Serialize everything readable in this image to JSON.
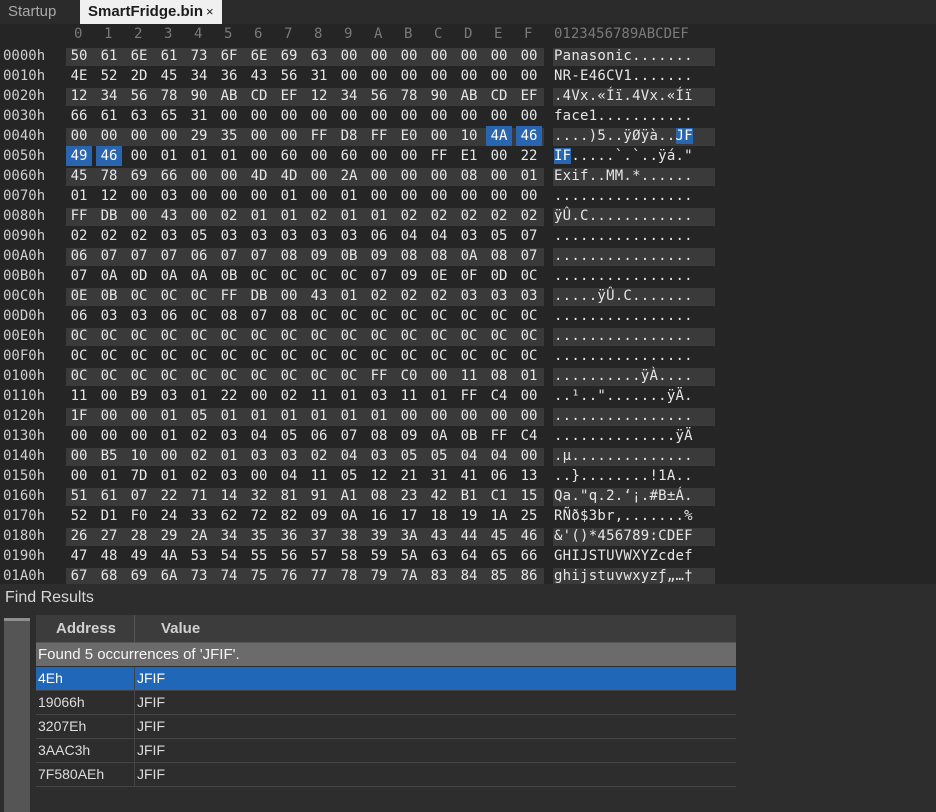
{
  "tabs": [
    {
      "label": "Startup",
      "active": false
    },
    {
      "label": "SmartFridge.bin",
      "active": true,
      "close": "×"
    }
  ],
  "hex_header": {
    "columns": [
      "0",
      "1",
      "2",
      "3",
      "4",
      "5",
      "6",
      "7",
      "8",
      "9",
      "A",
      "B",
      "C",
      "D",
      "E",
      "F"
    ],
    "ascii_header": "0123456789ABCDEF"
  },
  "selection": "JFIF at offset 4Eh–51h",
  "rows": [
    {
      "addr": "0000h",
      "bytes": [
        "50",
        "61",
        "6E",
        "61",
        "73",
        "6F",
        "6E",
        "69",
        "63",
        "00",
        "00",
        "00",
        "00",
        "00",
        "00",
        "00"
      ],
      "ascii": "Panasonic......."
    },
    {
      "addr": "0010h",
      "bytes": [
        "4E",
        "52",
        "2D",
        "45",
        "34",
        "36",
        "43",
        "56",
        "31",
        "00",
        "00",
        "00",
        "00",
        "00",
        "00",
        "00"
      ],
      "ascii": "NR-E46CV1......."
    },
    {
      "addr": "0020h",
      "bytes": [
        "12",
        "34",
        "56",
        "78",
        "90",
        "AB",
        "CD",
        "EF",
        "12",
        "34",
        "56",
        "78",
        "90",
        "AB",
        "CD",
        "EF"
      ],
      "ascii": ".4Vx.«Íï.4Vx.«Íï"
    },
    {
      "addr": "0030h",
      "bytes": [
        "66",
        "61",
        "63",
        "65",
        "31",
        "00",
        "00",
        "00",
        "00",
        "00",
        "00",
        "00",
        "00",
        "00",
        "00",
        "00"
      ],
      "ascii": "face1..........."
    },
    {
      "addr": "0040h",
      "bytes": [
        "00",
        "00",
        "00",
        "00",
        "29",
        "35",
        "00",
        "00",
        "FF",
        "D8",
        "FF",
        "E0",
        "00",
        "10",
        "4A",
        "46"
      ],
      "ascii": "....)5..ÿØÿà..JF"
    },
    {
      "addr": "0050h",
      "bytes": [
        "49",
        "46",
        "00",
        "01",
        "01",
        "01",
        "00",
        "60",
        "00",
        "60",
        "00",
        "00",
        "FF",
        "E1",
        "00",
        "22"
      ],
      "ascii": "IF.....`.`..ÿá.\""
    },
    {
      "addr": "0060h",
      "bytes": [
        "45",
        "78",
        "69",
        "66",
        "00",
        "00",
        "4D",
        "4D",
        "00",
        "2A",
        "00",
        "00",
        "00",
        "08",
        "00",
        "01"
      ],
      "ascii": "Exif..MM.*......"
    },
    {
      "addr": "0070h",
      "bytes": [
        "01",
        "12",
        "00",
        "03",
        "00",
        "00",
        "00",
        "01",
        "00",
        "01",
        "00",
        "00",
        "00",
        "00",
        "00",
        "00"
      ],
      "ascii": "................"
    },
    {
      "addr": "0080h",
      "bytes": [
        "FF",
        "DB",
        "00",
        "43",
        "00",
        "02",
        "01",
        "01",
        "02",
        "01",
        "01",
        "02",
        "02",
        "02",
        "02",
        "02"
      ],
      "ascii": "ÿÛ.C............"
    },
    {
      "addr": "0090h",
      "bytes": [
        "02",
        "02",
        "02",
        "03",
        "05",
        "03",
        "03",
        "03",
        "03",
        "03",
        "06",
        "04",
        "04",
        "03",
        "05",
        "07"
      ],
      "ascii": "................"
    },
    {
      "addr": "00A0h",
      "bytes": [
        "06",
        "07",
        "07",
        "07",
        "06",
        "07",
        "07",
        "08",
        "09",
        "0B",
        "09",
        "08",
        "08",
        "0A",
        "08",
        "07"
      ],
      "ascii": "................"
    },
    {
      "addr": "00B0h",
      "bytes": [
        "07",
        "0A",
        "0D",
        "0A",
        "0A",
        "0B",
        "0C",
        "0C",
        "0C",
        "0C",
        "07",
        "09",
        "0E",
        "0F",
        "0D",
        "0C"
      ],
      "ascii": "................"
    },
    {
      "addr": "00C0h",
      "bytes": [
        "0E",
        "0B",
        "0C",
        "0C",
        "0C",
        "FF",
        "DB",
        "00",
        "43",
        "01",
        "02",
        "02",
        "02",
        "03",
        "03",
        "03"
      ],
      "ascii": ".....ÿÛ.C......."
    },
    {
      "addr": "00D0h",
      "bytes": [
        "06",
        "03",
        "03",
        "06",
        "0C",
        "08",
        "07",
        "08",
        "0C",
        "0C",
        "0C",
        "0C",
        "0C",
        "0C",
        "0C",
        "0C"
      ],
      "ascii": "................"
    },
    {
      "addr": "00E0h",
      "bytes": [
        "0C",
        "0C",
        "0C",
        "0C",
        "0C",
        "0C",
        "0C",
        "0C",
        "0C",
        "0C",
        "0C",
        "0C",
        "0C",
        "0C",
        "0C",
        "0C"
      ],
      "ascii": "................"
    },
    {
      "addr": "00F0h",
      "bytes": [
        "0C",
        "0C",
        "0C",
        "0C",
        "0C",
        "0C",
        "0C",
        "0C",
        "0C",
        "0C",
        "0C",
        "0C",
        "0C",
        "0C",
        "0C",
        "0C"
      ],
      "ascii": "................"
    },
    {
      "addr": "0100h",
      "bytes": [
        "0C",
        "0C",
        "0C",
        "0C",
        "0C",
        "0C",
        "0C",
        "0C",
        "0C",
        "0C",
        "FF",
        "C0",
        "00",
        "11",
        "08",
        "01"
      ],
      "ascii": "..........ÿÀ...."
    },
    {
      "addr": "0110h",
      "bytes": [
        "11",
        "00",
        "B9",
        "03",
        "01",
        "22",
        "00",
        "02",
        "11",
        "01",
        "03",
        "11",
        "01",
        "FF",
        "C4",
        "00"
      ],
      "ascii": "..¹..\".......ÿÄ."
    },
    {
      "addr": "0120h",
      "bytes": [
        "1F",
        "00",
        "00",
        "01",
        "05",
        "01",
        "01",
        "01",
        "01",
        "01",
        "01",
        "00",
        "00",
        "00",
        "00",
        "00"
      ],
      "ascii": "................"
    },
    {
      "addr": "0130h",
      "bytes": [
        "00",
        "00",
        "00",
        "01",
        "02",
        "03",
        "04",
        "05",
        "06",
        "07",
        "08",
        "09",
        "0A",
        "0B",
        "FF",
        "C4"
      ],
      "ascii": "..............ÿÄ"
    },
    {
      "addr": "0140h",
      "bytes": [
        "00",
        "B5",
        "10",
        "00",
        "02",
        "01",
        "03",
        "03",
        "02",
        "04",
        "03",
        "05",
        "05",
        "04",
        "04",
        "00"
      ],
      "ascii": ".µ.............."
    },
    {
      "addr": "0150h",
      "bytes": [
        "00",
        "01",
        "7D",
        "01",
        "02",
        "03",
        "00",
        "04",
        "11",
        "05",
        "12",
        "21",
        "31",
        "41",
        "06",
        "13"
      ],
      "ascii": "..}........!1A.."
    },
    {
      "addr": "0160h",
      "bytes": [
        "51",
        "61",
        "07",
        "22",
        "71",
        "14",
        "32",
        "81",
        "91",
        "A1",
        "08",
        "23",
        "42",
        "B1",
        "C1",
        "15"
      ],
      "ascii": "Qa.\"q.2.‘¡.#B±Á."
    },
    {
      "addr": "0170h",
      "bytes": [
        "52",
        "D1",
        "F0",
        "24",
        "33",
        "62",
        "72",
        "82",
        "09",
        "0A",
        "16",
        "17",
        "18",
        "19",
        "1A",
        "25"
      ],
      "ascii": "RÑð$3br,.......%"
    },
    {
      "addr": "0180h",
      "bytes": [
        "26",
        "27",
        "28",
        "29",
        "2A",
        "34",
        "35",
        "36",
        "37",
        "38",
        "39",
        "3A",
        "43",
        "44",
        "45",
        "46"
      ],
      "ascii": "&'()*456789:CDEF"
    },
    {
      "addr": "0190h",
      "bytes": [
        "47",
        "48",
        "49",
        "4A",
        "53",
        "54",
        "55",
        "56",
        "57",
        "58",
        "59",
        "5A",
        "63",
        "64",
        "65",
        "66"
      ],
      "ascii": "GHIJSTUVWXYZcdef"
    },
    {
      "addr": "01A0h",
      "bytes": [
        "67",
        "68",
        "69",
        "6A",
        "73",
        "74",
        "75",
        "76",
        "77",
        "78",
        "79",
        "7A",
        "83",
        "84",
        "85",
        "86"
      ],
      "ascii": "ghijstuvwxyzƒ„…†"
    }
  ],
  "find_results": {
    "title": "Find Results",
    "col_address": "Address",
    "col_value": "Value",
    "summary": "Found 5 occurrences of 'JFIF'.",
    "results": [
      {
        "address": "4Eh",
        "value": "JFIF",
        "selected": true
      },
      {
        "address": "19066h",
        "value": "JFIF",
        "selected": false
      },
      {
        "address": "3207Eh",
        "value": "JFIF",
        "selected": false
      },
      {
        "address": "3AAC3h",
        "value": "JFIF",
        "selected": false
      },
      {
        "address": "7F580AEh",
        "value": "JFIF",
        "selected": false
      }
    ]
  },
  "colors": {
    "accent": "#2a65b0",
    "background": "#252526",
    "alt_row": "#3a3a3a"
  }
}
